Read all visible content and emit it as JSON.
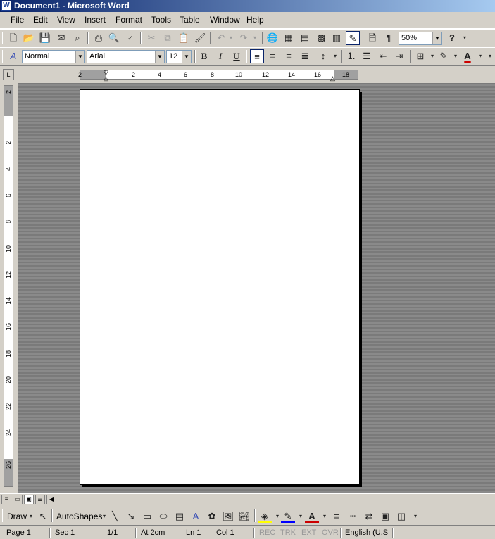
{
  "window": {
    "title": "Document1 - Microsoft Word",
    "icon": "word-icon"
  },
  "menu": [
    "File",
    "Edit",
    "View",
    "Insert",
    "Format",
    "Tools",
    "Table",
    "Window",
    "Help"
  ],
  "toolbar": {
    "zoom": "50%",
    "help_glyph": "?"
  },
  "format": {
    "style": "Normal",
    "font": "Arial",
    "size": "12",
    "bold": "B",
    "italic": "I",
    "underline": "U"
  },
  "ruler": {
    "h_labels": [
      "2",
      "2",
      "4",
      "6",
      "8",
      "10",
      "12",
      "14",
      "16",
      "18"
    ],
    "v_labels": [
      "2",
      "2",
      "4",
      "6",
      "8",
      "10",
      "12",
      "14",
      "16",
      "18",
      "20",
      "22",
      "24",
      "26"
    ],
    "corner_glyph": "L"
  },
  "draw": {
    "draw_label": "Draw",
    "autoshapes_label": "AutoShapes",
    "accent_font_color": "#cc0000",
    "accent_highlight": "#ff00ff",
    "accent_line": "#0000ff",
    "accent_fill": "#ffff00"
  },
  "status": {
    "page": "Page 1",
    "sec": "Sec 1",
    "of": "1/1",
    "at": "At 2cm",
    "ln": "Ln 1",
    "col": "Col 1",
    "rec": "REC",
    "trk": "TRK",
    "ext": "EXT",
    "ovr": "OVR",
    "lang": "English (U.S"
  }
}
